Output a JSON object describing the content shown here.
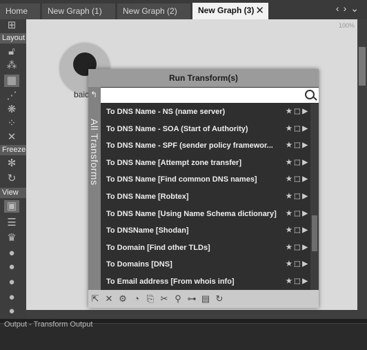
{
  "tabs": [
    {
      "label": "Home"
    },
    {
      "label": "New Graph (1)"
    },
    {
      "label": "New Graph (2)"
    },
    {
      "label": "New Graph (3)",
      "active": true
    }
  ],
  "toolbar": {
    "layout_label": "Layout",
    "freeze_label": "Freeze",
    "view_label": "View"
  },
  "canvas": {
    "zoom": "100%",
    "node_label": "baid"
  },
  "panel": {
    "title": "Run Transform(s)",
    "side_tab": "All Transforms",
    "search_placeholder": "",
    "transforms": [
      "To DNS Name - NS (name server)",
      "To DNS Name - SOA (Start of Authority)",
      "To DNS Name - SPF (sender policy framewor...",
      "To DNS Name [Attempt zone transfer]",
      "To DNS Name [Find common DNS names]",
      "To DNS Name [Robtex]",
      "To DNS Name [Using Name Schema dictionary]",
      "To DNSName [Shodan]",
      "To Domain [Find other TLDs]",
      "To Domains [DNS]",
      "To Email address [From whois info]"
    ]
  },
  "output": {
    "title": "Output - Transform Output"
  }
}
